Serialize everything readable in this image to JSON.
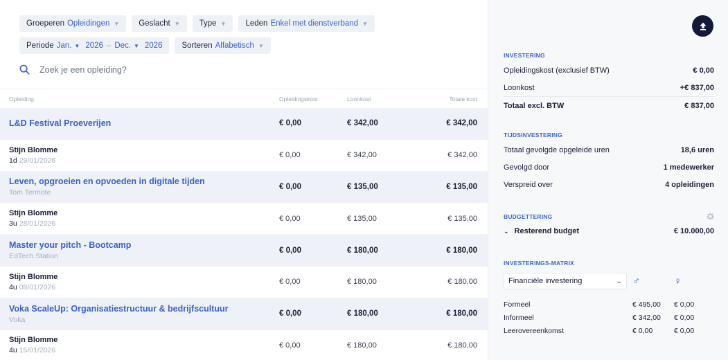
{
  "filters": {
    "group_label": "Groeperen",
    "group_value": "Opleidingen",
    "gender_label": "Geslacht",
    "type_label": "Type",
    "members_label": "Leden",
    "members_value": "Enkel met dienstverband",
    "period_label": "Periode",
    "period_from_month": "Jan.",
    "period_from_year": "2026",
    "period_sep": "–",
    "period_to_month": "Dec.",
    "period_to_year": "2026",
    "sort_label": "Sorteren",
    "sort_value": "Alfabetisch"
  },
  "search": {
    "placeholder": "Zoek je een opleiding?"
  },
  "table": {
    "headers": [
      "Opleiding",
      "Opleidingskost",
      "Loonkost",
      "Totale kost"
    ],
    "groups": [
      {
        "title": "L&D Festival Proeverijen",
        "subtitle": "",
        "opleidingskost": "€ 0,00",
        "loonkost": "€ 342,00",
        "totaal": "€ 342,00",
        "person": {
          "name": "Stijn Blomme",
          "duration": "1d",
          "date": "29/01/2026",
          "opleidingskost": "€ 0,00",
          "loonkost": "€ 342,00",
          "totaal": "€ 342,00"
        }
      },
      {
        "title": "Leven, opgroeien en opvoeden in digitale tijden",
        "subtitle": "Tom Termote",
        "opleidingskost": "€ 0,00",
        "loonkost": "€ 135,00",
        "totaal": "€ 135,00",
        "person": {
          "name": "Stijn Blomme",
          "duration": "3u",
          "date": "28/01/2026",
          "opleidingskost": "€ 0,00",
          "loonkost": "€ 135,00",
          "totaal": "€ 135,00"
        }
      },
      {
        "title": "Master your pitch - Bootcamp",
        "subtitle": "EdTech Station",
        "opleidingskost": "€ 0,00",
        "loonkost": "€ 180,00",
        "totaal": "€ 180,00",
        "person": {
          "name": "Stijn Blomme",
          "duration": "4u",
          "date": "08/01/2026",
          "opleidingskost": "€ 0,00",
          "loonkost": "€ 180,00",
          "totaal": "€ 180,00"
        }
      },
      {
        "title": "Voka ScaleUp: Organisatiestructuur & bedrijfscultuur",
        "subtitle": "Voka",
        "opleidingskost": "€ 0,00",
        "loonkost": "€ 180,00",
        "totaal": "€ 180,00",
        "person": {
          "name": "Stijn Blomme",
          "duration": "4u",
          "date": "15/01/2026",
          "opleidingskost": "€ 0,00",
          "loonkost": "€ 180,00",
          "totaal": "€ 180,00"
        }
      }
    ]
  },
  "sidebar": {
    "investering": {
      "title": "INVESTERING",
      "rows": [
        {
          "label": "Opleidingskost (exclusief BTW)",
          "value": "€ 0,00"
        },
        {
          "label": "Loonkost",
          "value": "+€ 837,00"
        },
        {
          "label": "Totaal excl. BTW",
          "value": "€ 837,00"
        }
      ]
    },
    "tijd": {
      "title": "TIJDSINVESTERING",
      "rows": [
        {
          "label": "Totaal gevolgde opgeleide uren",
          "value": "18,6 uren"
        },
        {
          "label": "Gevolgd door",
          "value": "1 medewerker"
        },
        {
          "label": "Verspreid over",
          "value": "4 opleidingen"
        }
      ]
    },
    "budget": {
      "title": "BUDGETTERING",
      "label": "Resterend budget",
      "value": "€ 10.000,00"
    },
    "matrix": {
      "title": "INVESTERINGS-MATRIX",
      "select": "Financiële investering",
      "male_symbol": "♂",
      "female_symbol": "♀",
      "rows": [
        {
          "label": "Formeel",
          "male": "€ 495,00",
          "female": "€ 0,00"
        },
        {
          "label": "Informeel",
          "male": "€ 342,00",
          "female": "€ 0,00"
        },
        {
          "label": "Leerovereenkomst",
          "male": "€ 0,00",
          "female": "€ 0,00"
        }
      ]
    }
  },
  "colors": {
    "accent": "#3a62c7",
    "dark": "#14193a",
    "group_row": "#eef1f7"
  },
  "icons": {
    "search": "search-icon",
    "upload": "upload-icon",
    "gear": "gear-icon",
    "chevron": "chevron-down-icon"
  }
}
